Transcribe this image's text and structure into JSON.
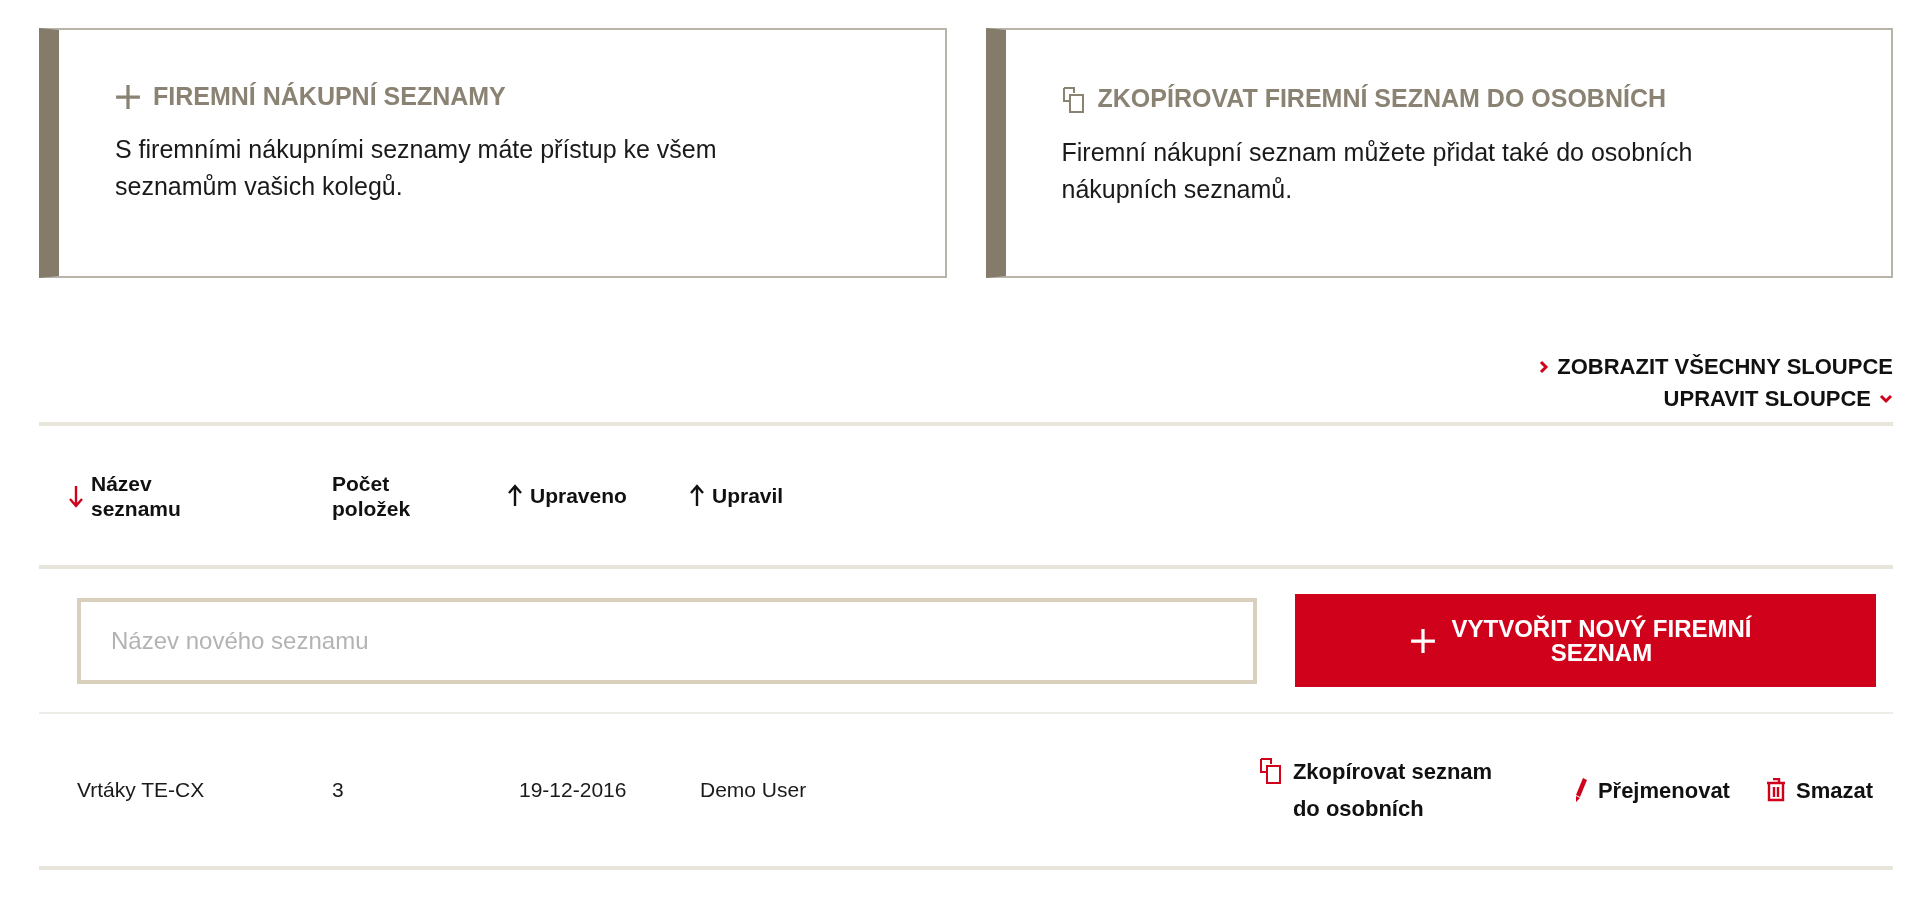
{
  "cards": [
    {
      "kind": "plus",
      "title": "FIREMNÍ NÁKUPNÍ SEZNAMY",
      "text": "S firemními nákupními seznamy máte přístup ke všem seznamům vašich kolegů."
    },
    {
      "kind": "copy",
      "title": "ZKOPÍROVAT FIREMNÍ SEZNAM DO OSOBNÍCH",
      "text": "Firemní nákupní seznam můžete přidat také do osobních nákupních seznamů."
    }
  ],
  "column_links": [
    {
      "kind": "chevron-right",
      "label": "ZOBRAZIT VŠECHNY SLOUPCE"
    },
    {
      "kind": "chevron-down",
      "label": "UPRAVIT SLOUPCE"
    }
  ],
  "table": {
    "columns": [
      {
        "label": "Název seznamu",
        "kind": "sorted-desc"
      },
      {
        "label": "Počet položek",
        "kind": "unsorted"
      },
      {
        "label": "Upraveno",
        "kind": "sorted-asc"
      },
      {
        "label": "Upravil",
        "kind": "sorted-asc"
      }
    ],
    "new_list": {
      "placeholder": "Název nového seznamu",
      "button": "VYTVOŘIT NOVÝ FIREMNÍ SEZNAM"
    },
    "rows": [
      {
        "cells": [
          "Vrtáky TE-CX",
          "3",
          "19-12-2016",
          "Demo User"
        ],
        "actions": [
          {
            "kind": "copy",
            "label": "Zkopírovat seznam do osobních"
          },
          {
            "kind": "rename",
            "label": "Přejmenovat"
          },
          {
            "kind": "delete",
            "label": "Smazat"
          }
        ]
      }
    ]
  }
}
